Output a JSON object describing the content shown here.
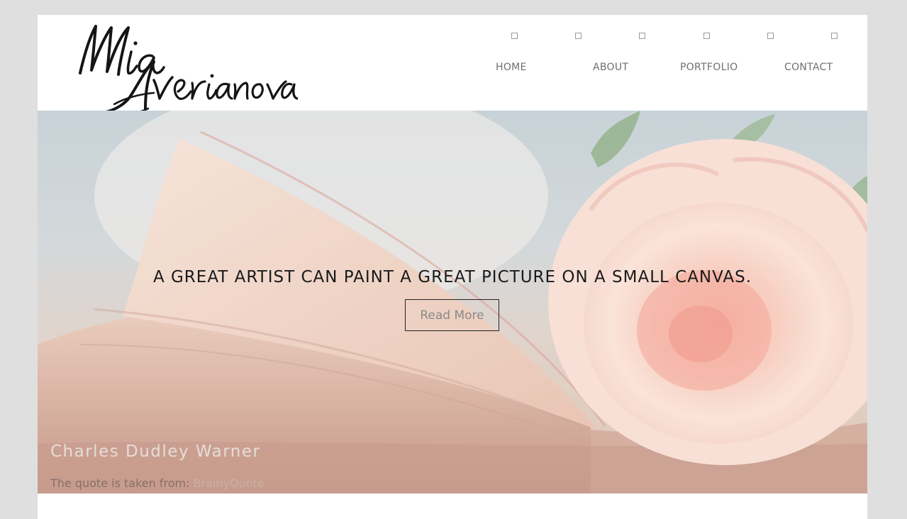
{
  "site": {
    "logo_text": "Mia Averianova"
  },
  "nav": {
    "icons": [
      "square-icon",
      "square-icon",
      "square-icon",
      "square-icon",
      "square-icon",
      "square-icon"
    ],
    "items": [
      {
        "label": "HOME"
      },
      {
        "label": "ABOUT"
      },
      {
        "label": "PORTFOLIO"
      },
      {
        "label": "CONTACT"
      }
    ]
  },
  "hero": {
    "quote": "A GREAT ARTIST CAN PAINT A GREAT PICTURE ON A SMALL CANVAS.",
    "button_label": "Read More",
    "author": "Charles Dudley Warner",
    "source_prefix": "The quote is taken from: ",
    "source_link": "BrainyQuote"
  },
  "colors": {
    "background": "#dfdfdf",
    "nav_text": "#6f6f6f",
    "quote_text": "#1a1a1a"
  }
}
